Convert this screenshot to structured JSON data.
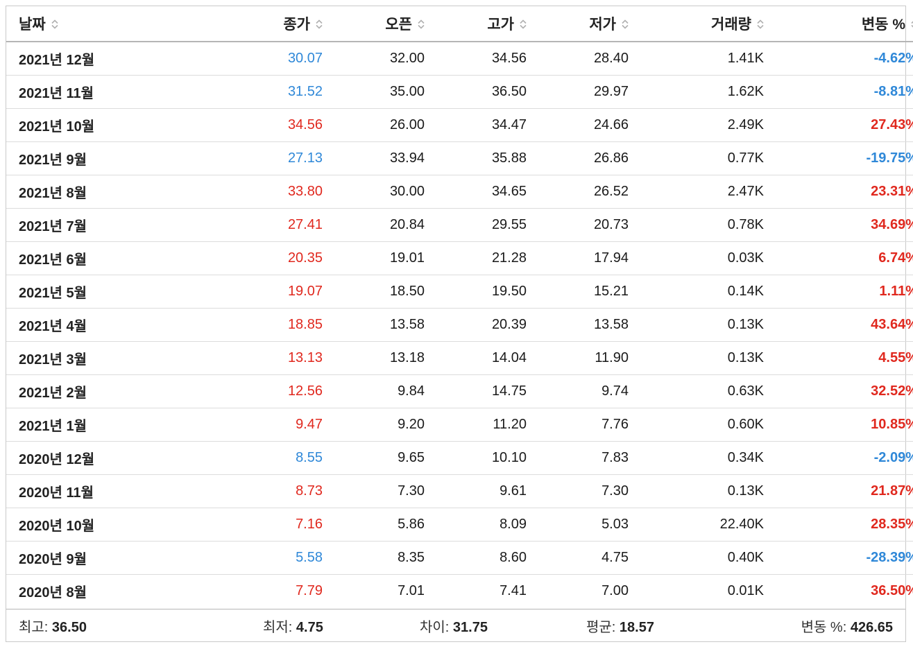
{
  "table": {
    "headers": {
      "date": "날짜",
      "close": "종가",
      "open": "오픈",
      "high": "고가",
      "low": "저가",
      "volume": "거래량",
      "change": "변동 %"
    },
    "rows": [
      {
        "date": "2021년 12월",
        "close": "30.07",
        "open": "32.00",
        "high": "34.56",
        "low": "28.40",
        "volume": "1.41K",
        "change": "-4.62%",
        "dir": "down"
      },
      {
        "date": "2021년 11월",
        "close": "31.52",
        "open": "35.00",
        "high": "36.50",
        "low": "29.97",
        "volume": "1.62K",
        "change": "-8.81%",
        "dir": "down"
      },
      {
        "date": "2021년 10월",
        "close": "34.56",
        "open": "26.00",
        "high": "34.47",
        "low": "24.66",
        "volume": "2.49K",
        "change": "27.43%",
        "dir": "up"
      },
      {
        "date": "2021년 9월",
        "close": "27.13",
        "open": "33.94",
        "high": "35.88",
        "low": "26.86",
        "volume": "0.77K",
        "change": "-19.75%",
        "dir": "down"
      },
      {
        "date": "2021년 8월",
        "close": "33.80",
        "open": "30.00",
        "high": "34.65",
        "low": "26.52",
        "volume": "2.47K",
        "change": "23.31%",
        "dir": "up"
      },
      {
        "date": "2021년 7월",
        "close": "27.41",
        "open": "20.84",
        "high": "29.55",
        "low": "20.73",
        "volume": "0.78K",
        "change": "34.69%",
        "dir": "up"
      },
      {
        "date": "2021년 6월",
        "close": "20.35",
        "open": "19.01",
        "high": "21.28",
        "low": "17.94",
        "volume": "0.03K",
        "change": "6.74%",
        "dir": "up"
      },
      {
        "date": "2021년 5월",
        "close": "19.07",
        "open": "18.50",
        "high": "19.50",
        "low": "15.21",
        "volume": "0.14K",
        "change": "1.11%",
        "dir": "up"
      },
      {
        "date": "2021년 4월",
        "close": "18.85",
        "open": "13.58",
        "high": "20.39",
        "low": "13.58",
        "volume": "0.13K",
        "change": "43.64%",
        "dir": "up"
      },
      {
        "date": "2021년 3월",
        "close": "13.13",
        "open": "13.18",
        "high": "14.04",
        "low": "11.90",
        "volume": "0.13K",
        "change": "4.55%",
        "dir": "up"
      },
      {
        "date": "2021년 2월",
        "close": "12.56",
        "open": "9.84",
        "high": "14.75",
        "low": "9.74",
        "volume": "0.63K",
        "change": "32.52%",
        "dir": "up"
      },
      {
        "date": "2021년 1월",
        "close": "9.47",
        "open": "9.20",
        "high": "11.20",
        "low": "7.76",
        "volume": "0.60K",
        "change": "10.85%",
        "dir": "up"
      },
      {
        "date": "2020년 12월",
        "close": "8.55",
        "open": "9.65",
        "high": "10.10",
        "low": "7.83",
        "volume": "0.34K",
        "change": "-2.09%",
        "dir": "down"
      },
      {
        "date": "2020년 11월",
        "close": "8.73",
        "open": "7.30",
        "high": "9.61",
        "low": "7.30",
        "volume": "0.13K",
        "change": "21.87%",
        "dir": "up"
      },
      {
        "date": "2020년 10월",
        "close": "7.16",
        "open": "5.86",
        "high": "8.09",
        "low": "5.03",
        "volume": "22.40K",
        "change": "28.35%",
        "dir": "up"
      },
      {
        "date": "2020년 9월",
        "close": "5.58",
        "open": "8.35",
        "high": "8.60",
        "low": "4.75",
        "volume": "0.40K",
        "change": "-28.39%",
        "dir": "down"
      },
      {
        "date": "2020년 8월",
        "close": "7.79",
        "open": "7.01",
        "high": "7.41",
        "low": "7.00",
        "volume": "0.01K",
        "change": "36.50%",
        "dir": "up"
      }
    ]
  },
  "summary": {
    "highest_label": "최고:",
    "highest_value": "36.50",
    "lowest_label": "최저:",
    "lowest_value": "4.75",
    "difference_label": "차이:",
    "difference_value": "31.75",
    "average_label": "평균:",
    "average_value": "18.57",
    "change_label": "변동 %:",
    "change_value": "426.65"
  },
  "colors": {
    "up": "#e0281e",
    "down": "#2f88d8",
    "sort_icon": "#b0b0b0"
  },
  "icons": {
    "sort": "sort-icon"
  }
}
